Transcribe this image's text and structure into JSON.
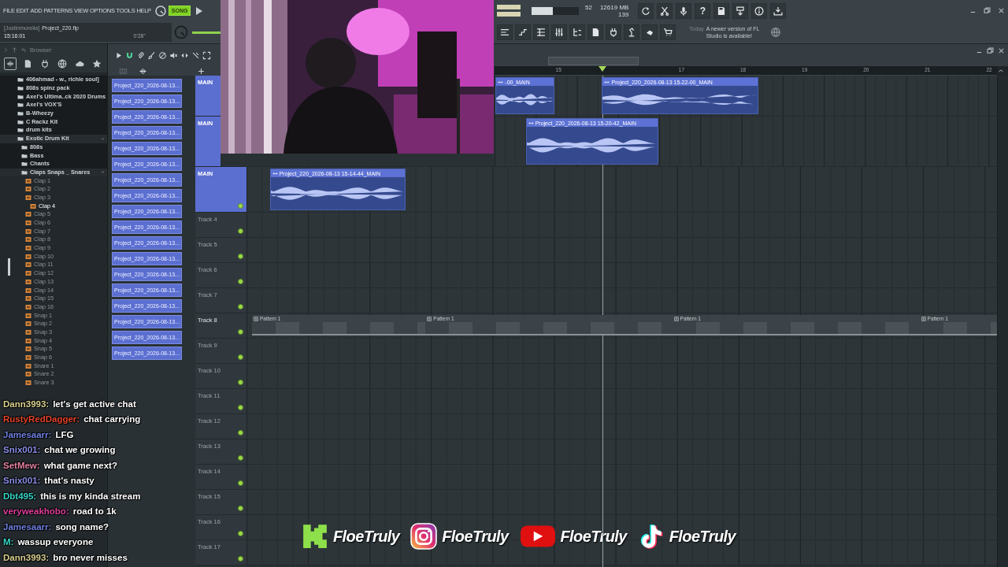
{
  "menu": [
    "FILE",
    "EDIT",
    "ADD",
    "PATTERNS",
    "VIEW",
    "OPTIONS",
    "TOOLS",
    "HELP"
  ],
  "transport": {
    "mode": "SONG",
    "selected": true
  },
  "project": {
    "owner": "[Justinmorella]",
    "file": "Project_220.flp",
    "time": "15:16:01",
    "length": "0'28\""
  },
  "performance": {
    "level": 0.45,
    "voices": "52",
    "memory": "12619 MB",
    "polyphony": "139"
  },
  "help": "?",
  "hint": {
    "label": "Today",
    "message": "A newer version of FL Studio is available!"
  },
  "browser": {
    "title": "Browser",
    "tree": [
      {
        "label": "406ahmad - w., richie soul]",
        "kind": "folder",
        "expanded": false
      },
      {
        "label": "808s spinz pack",
        "kind": "folder",
        "expanded": false
      },
      {
        "label": "Axel's Ultima..ck 2020 Drums",
        "kind": "folder",
        "expanded": false
      },
      {
        "label": "Axel's VOX'S",
        "kind": "folder",
        "expanded": false
      },
      {
        "label": "B-Wheezy",
        "kind": "folder",
        "expanded": false
      },
      {
        "label": "C Rackz Kit",
        "kind": "folder",
        "expanded": false
      },
      {
        "label": "drum kits",
        "kind": "folder",
        "expanded": false
      },
      {
        "label": "Exotic Drum Kit",
        "kind": "folder",
        "expanded": true,
        "children": [
          {
            "label": "808s",
            "kind": "folder",
            "expanded": false
          },
          {
            "label": "Bass",
            "kind": "folder",
            "expanded": false
          },
          {
            "label": "Chants",
            "kind": "folder",
            "expanded": false
          },
          {
            "label": "Claps Snaps _ Snares",
            "kind": "folder",
            "expanded": true,
            "children": [
              {
                "label": "Clap 1",
                "kind": "sample",
                "selected": false
              },
              {
                "label": "Clap 2",
                "kind": "sample",
                "selected": false
              },
              {
                "label": "Clap 3",
                "kind": "sample",
                "selected": false
              },
              {
                "label": "Clap 4",
                "kind": "sample",
                "selected": true
              },
              {
                "label": "Clap 5",
                "kind": "sample",
                "selected": false
              },
              {
                "label": "Clap 6",
                "kind": "sample",
                "selected": false
              },
              {
                "label": "Clap 7",
                "kind": "sample",
                "selected": false
              },
              {
                "label": "Clap 8",
                "kind": "sample",
                "selected": false
              },
              {
                "label": "Clap 9",
                "kind": "sample",
                "selected": false
              },
              {
                "label": "Clap 10",
                "kind": "sample",
                "selected": false
              },
              {
                "label": "Clap 11",
                "kind": "sample",
                "selected": false
              },
              {
                "label": "Clap 12",
                "kind": "sample",
                "selected": false
              },
              {
                "label": "Clap 13",
                "kind": "sample",
                "selected": false
              },
              {
                "label": "Clap 14",
                "kind": "sample",
                "selected": false
              },
              {
                "label": "Clap 15",
                "kind": "sample",
                "selected": false
              },
              {
                "label": "Clap 16",
                "kind": "sample",
                "selected": false
              },
              {
                "label": "Snap 1",
                "kind": "sample",
                "selected": false
              },
              {
                "label": "Snap 2",
                "kind": "sample",
                "selected": false
              },
              {
                "label": "Snap 3",
                "kind": "sample",
                "selected": false
              },
              {
                "label": "Snap 4",
                "kind": "sample",
                "selected": false
              },
              {
                "label": "Snap 5",
                "kind": "sample",
                "selected": false
              },
              {
                "label": "Snap 6",
                "kind": "sample",
                "selected": false
              },
              {
                "label": "Snare 1",
                "kind": "sample",
                "selected": false
              },
              {
                "label": "Snare 2",
                "kind": "sample",
                "selected": false
              },
              {
                "label": "Snare 3",
                "kind": "sample",
                "selected": false
              }
            ]
          }
        ]
      }
    ]
  },
  "picker": [
    "Project_220_2026-08-13...",
    "Project_220_2026-08-13...",
    "Project_220_2026-08-13...",
    "Project_220_2026-08-13...",
    "Project_220_2026-08-13...",
    "Project_220_2026-08-13...",
    "Project_220_2026-08-13...",
    "Project_220_2026-08-13...",
    "Project_220_2026-08-13...",
    "Project_220_2026-08-13...",
    "Project_220_2026-08-13...",
    "Project_220_2026-08-13...",
    "Project_220_2026-08-13...",
    "Project_220_2026-08-13...",
    "Project_220_2026-08-13...",
    "Project_220_2026-08-13...",
    "Project_220_2026-08-13...",
    "Project_220_2026-08-13..."
  ],
  "playlist": {
    "ruler": [
      "15",
      "17",
      "18",
      "19",
      "20",
      "21",
      "22"
    ],
    "tracks": [
      {
        "name": "MAIN",
        "kind": "audio",
        "clips": [
          {
            "label": "-00_MAIN"
          },
          {
            "label": "Project_220_2026-08-13 15-22-00_MAIN"
          }
        ]
      },
      {
        "name": "MAIN",
        "kind": "audio",
        "clips": [
          {
            "label": "Project_220_2026-08-13 15-20-42_MAIN"
          }
        ]
      },
      {
        "name": "MAIN",
        "kind": "audio",
        "clips": [
          {
            "label": "Project_220_2026-08-13 15-14-44_MAIN"
          }
        ]
      },
      {
        "name": "Track 4",
        "kind": "empty"
      },
      {
        "name": "Track 5",
        "kind": "empty"
      },
      {
        "name": "Track 6",
        "kind": "empty"
      },
      {
        "name": "Track 7",
        "kind": "empty"
      },
      {
        "name": "Track 8",
        "kind": "pattern",
        "clips": [
          {
            "label": "Pattern 1"
          },
          {
            "label": "Pattern 1"
          },
          {
            "label": "Pattern 1"
          },
          {
            "label": "Pattern 1"
          }
        ]
      },
      {
        "name": "Track 9",
        "kind": "empty"
      },
      {
        "name": "Track 10",
        "kind": "empty"
      },
      {
        "name": "Track 11",
        "kind": "empty"
      },
      {
        "name": "Track 12",
        "kind": "empty"
      },
      {
        "name": "Track 13",
        "kind": "empty"
      },
      {
        "name": "Track 14",
        "kind": "empty"
      },
      {
        "name": "Track 15",
        "kind": "empty"
      },
      {
        "name": "Track 16",
        "kind": "empty"
      },
      {
        "name": "Track 17",
        "kind": "empty"
      }
    ]
  },
  "chat": [
    {
      "user": "Dann3993:",
      "color": "#d8cf8e",
      "message": "let's get active chat"
    },
    {
      "user": "RustyRedDagger:",
      "color": "#e5432b",
      "message": "chat carrying"
    },
    {
      "user": "Jamesaarr:",
      "color": "#6f7fe0",
      "message": "LFG"
    },
    {
      "user": "Snix001:",
      "color": "#8b8ee8",
      "message": "chat we growing"
    },
    {
      "user": "SetMew:",
      "color": "#e3809e",
      "message": "what game next?"
    },
    {
      "user": "Snix001:",
      "color": "#8b8ee8",
      "message": "that's nasty"
    },
    {
      "user": "Dbt495:",
      "color": "#36d6c8",
      "message": "this is my kinda stream"
    },
    {
      "user": "veryweakhobo:",
      "color": "#e03f9c",
      "message": "road to 1k"
    },
    {
      "user": "Jamesaarr:",
      "color": "#6f7fe0",
      "message": "song name?"
    },
    {
      "user": "M:",
      "color": "#36d6c8",
      "message": "wassup everyone"
    },
    {
      "user": "Dann3993:",
      "color": "#d8cf8e",
      "message": "bro never misses"
    }
  ],
  "socials": [
    {
      "kind": "kick",
      "handle": "FloeTruly"
    },
    {
      "kind": "instagram",
      "handle": "FloeTruly"
    },
    {
      "kind": "youtube",
      "handle": "FloeTruly"
    },
    {
      "kind": "tiktok",
      "handle": "FloeTruly"
    }
  ]
}
